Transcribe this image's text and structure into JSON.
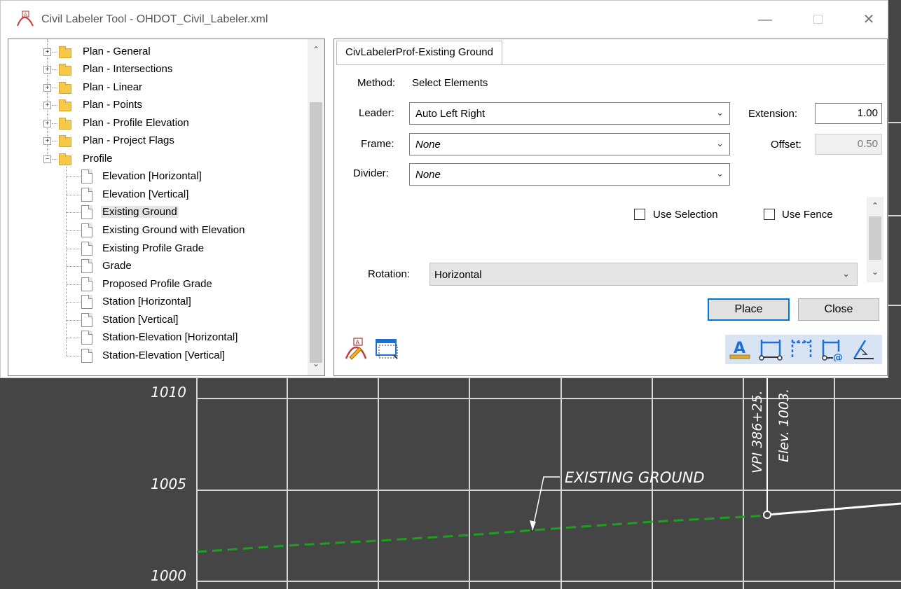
{
  "window": {
    "title": "Civil Labeler Tool - OHDOT_Civil_Labeler.xml",
    "minimize": "—",
    "close": "✕"
  },
  "tree": {
    "folders": [
      {
        "label": "Plan - General"
      },
      {
        "label": "Plan - Intersections"
      },
      {
        "label": "Plan - Linear"
      },
      {
        "label": "Plan - Points"
      },
      {
        "label": "Plan - Profile Elevation"
      },
      {
        "label": "Plan - Project Flags"
      },
      {
        "label": "Profile"
      }
    ],
    "profile_items": [
      "Elevation [Horizontal]",
      "Elevation [Vertical]",
      "Existing Ground",
      "Existing Ground with Elevation",
      "Existing Profile Grade",
      "Grade",
      "Proposed Profile Grade",
      "Station [Horizontal]",
      "Station [Vertical]",
      "Station-Elevation [Horizontal]",
      "Station-Elevation [Vertical]"
    ],
    "selected": "Existing Ground"
  },
  "panel": {
    "tab_label": "CivLabelerProf-Existing Ground",
    "method_label": "Method:",
    "method_value": "Select Elements",
    "leader_label": "Leader:",
    "leader_value": "Auto Left Right",
    "frame_label": "Frame:",
    "frame_value": "None",
    "divider_label": "Divider:",
    "divider_value": "None",
    "extension_label": "Extension:",
    "extension_value": "1.00",
    "offset_label": "Offset:",
    "offset_value": "0.50",
    "use_selection_label": "Use Selection",
    "use_fence_label": "Use Fence",
    "rotation_label": "Rotation:",
    "rotation_value": "Horizontal",
    "place_label": "Place",
    "close_label": "Close"
  },
  "cad": {
    "y_labels": [
      "1010",
      "1005",
      "1000"
    ],
    "annotation": "EXISTING GROUND",
    "vpi_text": "VPI 386+25.",
    "elev_text": "Elev. 1003.",
    "colors": {
      "background": "#454545",
      "grid": "#d6d6d6",
      "dashed_line": "#1ea01e",
      "profile_line": "#ffffff"
    }
  }
}
